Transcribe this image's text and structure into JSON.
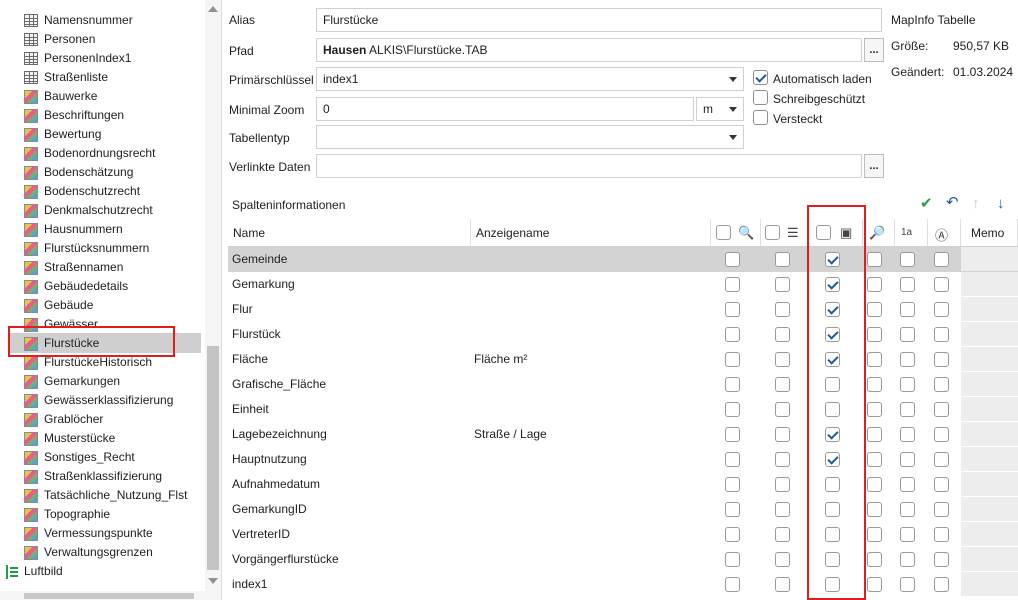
{
  "sidebar": {
    "items": [
      {
        "label": "Namensnummer",
        "icon": "table-icon"
      },
      {
        "label": "Personen",
        "icon": "table-icon"
      },
      {
        "label": "PersonenIndex1",
        "icon": "table-icon"
      },
      {
        "label": "Straßenliste",
        "icon": "table-icon"
      },
      {
        "label": "Bauwerke",
        "icon": "layer-icon"
      },
      {
        "label": "Beschriftungen",
        "icon": "layer-icon"
      },
      {
        "label": "Bewertung",
        "icon": "layer-icon"
      },
      {
        "label": "Bodenordnungsrecht",
        "icon": "layer-icon"
      },
      {
        "label": "Bodenschätzung",
        "icon": "layer-icon"
      },
      {
        "label": "Bodenschutzrecht",
        "icon": "layer-icon"
      },
      {
        "label": "Denkmalschutzrecht",
        "icon": "layer-icon"
      },
      {
        "label": "Hausnummern",
        "icon": "layer-icon"
      },
      {
        "label": "Flurstücksnummern",
        "icon": "layer-icon"
      },
      {
        "label": "Straßennamen",
        "icon": "layer-icon"
      },
      {
        "label": "Gebäudedetails",
        "icon": "layer-icon"
      },
      {
        "label": "Gebäude",
        "icon": "layer-icon"
      },
      {
        "label": "Gewässer",
        "icon": "layer-icon"
      },
      {
        "label": "Flurstücke",
        "icon": "layer-icon",
        "selected": true
      },
      {
        "label": "FlurstückeHistorisch",
        "icon": "layer-icon"
      },
      {
        "label": "Gemarkungen",
        "icon": "layer-icon"
      },
      {
        "label": "Gewässerklassifizierung",
        "icon": "layer-icon"
      },
      {
        "label": "Grablöcher",
        "icon": "layer-icon"
      },
      {
        "label": "Musterstücke",
        "icon": "layer-icon"
      },
      {
        "label": "Sonstiges_Recht",
        "icon": "layer-icon"
      },
      {
        "label": "Straßenklassifizierung",
        "icon": "layer-icon"
      },
      {
        "label": "Tatsächliche_Nutzung_Flst",
        "icon": "layer-icon"
      },
      {
        "label": "Topographie",
        "icon": "layer-icon"
      },
      {
        "label": "Vermessungspunkte",
        "icon": "layer-icon"
      },
      {
        "label": "Verwaltungsgrenzen",
        "icon": "layer-icon"
      }
    ],
    "root_item": {
      "label": "Luftbild",
      "icon": "luftbild-icon"
    }
  },
  "form": {
    "alias": {
      "label": "Alias",
      "value": "Flurstücke"
    },
    "pfad": {
      "label": "Pfad",
      "value_bold": "Hausen",
      "value_rest": " ALKIS\\Flurstücke.TAB"
    },
    "primary_key": {
      "label": "Primärschlüssel",
      "value": "index1"
    },
    "min_zoom": {
      "label": "Minimal Zoom",
      "value": "0",
      "unit": "m"
    },
    "table_type": {
      "label": "Tabellentyp",
      "value": ""
    },
    "linked_data": {
      "label": "Verlinkte Daten",
      "value": ""
    },
    "browse_label": "...",
    "options": [
      {
        "label": "Automatisch laden",
        "checked": true
      },
      {
        "label": "Schreibgeschützt",
        "checked": false
      },
      {
        "label": "Versteckt",
        "checked": false
      }
    ]
  },
  "info": {
    "title": "MapInfo Tabelle",
    "size_label": "Größe:",
    "size_value": "950,57 KB",
    "changed_label": "Geändert:",
    "changed_value": "01.03.2024"
  },
  "columns_section": {
    "title": "Spalteninformationen",
    "headers": {
      "name": "Name",
      "display_name": "Anzeigename",
      "icon_label": "1a",
      "memo": "Memo"
    },
    "rows": [
      {
        "name": "Gemeinde",
        "display": "",
        "checked": true,
        "selected": true
      },
      {
        "name": "Gemarkung",
        "display": "",
        "checked": true
      },
      {
        "name": "Flur",
        "display": "",
        "checked": true
      },
      {
        "name": "Flurstück",
        "display": "",
        "checked": true
      },
      {
        "name": "Fläche",
        "display": "Fläche m²",
        "checked": true
      },
      {
        "name": "Grafische_Fläche",
        "display": "",
        "checked": false
      },
      {
        "name": "Einheit",
        "display": "",
        "checked": false
      },
      {
        "name": "Lagebezeichnung",
        "display": "Straße / Lage",
        "checked": true
      },
      {
        "name": "Hauptnutzung",
        "display": "",
        "checked": true
      },
      {
        "name": "Aufnahmedatum",
        "display": "",
        "checked": false
      },
      {
        "name": "GemarkungID",
        "display": "",
        "checked": false
      },
      {
        "name": "VertreterID",
        "display": "",
        "checked": false
      },
      {
        "name": "Vorgängerflurstücke",
        "display": "",
        "checked": false
      },
      {
        "name": "index1",
        "display": "",
        "checked": false
      }
    ]
  },
  "colors": {
    "accent": "#1f5a9a",
    "highlight": "#e01e1e",
    "selected_row": "#d3d3d3",
    "check_green": "#2e9a3a"
  }
}
